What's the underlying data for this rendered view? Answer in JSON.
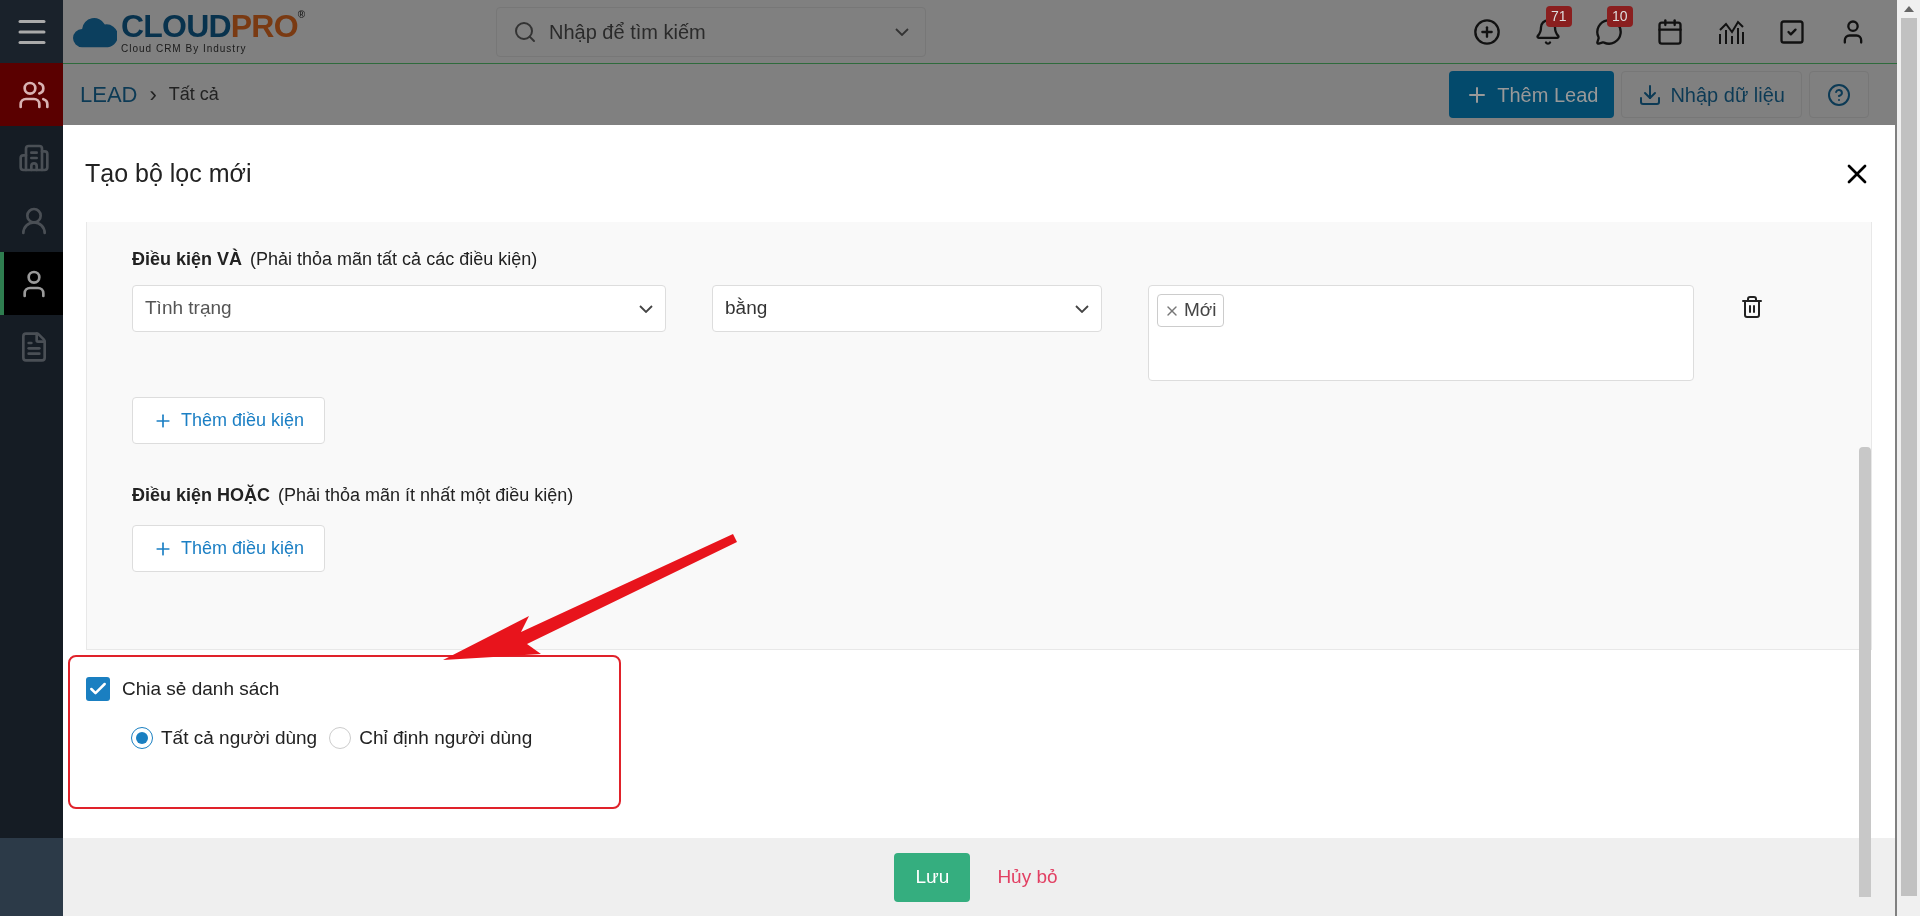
{
  "header": {
    "logo": {
      "brand_a": "CLOUD",
      "brand_b": "PRO",
      "mark": "®",
      "tagline": "Cloud CRM By Industry"
    },
    "search": {
      "placeholder": "Nhập để tìm kiếm"
    },
    "notifications": {
      "count": "71"
    },
    "messages": {
      "count": "10"
    }
  },
  "sidebar": {
    "items": [
      {
        "kind": "group",
        "selected": false
      },
      {
        "kind": "building",
        "selected": false
      },
      {
        "kind": "contact",
        "selected": false
      },
      {
        "kind": "person",
        "selected": true
      },
      {
        "kind": "file",
        "selected": false
      }
    ]
  },
  "breadcrumb": {
    "module": "LEAD",
    "separator": "›",
    "page": "Tất cả"
  },
  "actions": {
    "add": "Thêm Lead",
    "import": "Nhập dữ liệu"
  },
  "modal": {
    "title": "Tạo bộ lọc mới",
    "and_group": {
      "title": "Điều kiện VÀ",
      "hint": "(Phải thỏa mãn tất cả các điều kiện)",
      "add_button": "Thêm điều kiện",
      "conditions": [
        {
          "field": "Tình trạng",
          "operator": "bằng",
          "values": [
            "Mới"
          ]
        }
      ]
    },
    "or_group": {
      "title": "Điều kiện HOẶC",
      "hint": "(Phải thỏa mãn ít nhất một điều kiện)",
      "add_button": "Thêm điều kiện"
    },
    "share": {
      "label": "Chia sẻ danh sách",
      "checked": true,
      "options": [
        {
          "label": "Tất cả người dùng",
          "selected": true
        },
        {
          "label": "Chỉ định người dùng",
          "selected": false
        }
      ]
    },
    "save": "Lưu",
    "cancel": "Hủy bỏ"
  }
}
